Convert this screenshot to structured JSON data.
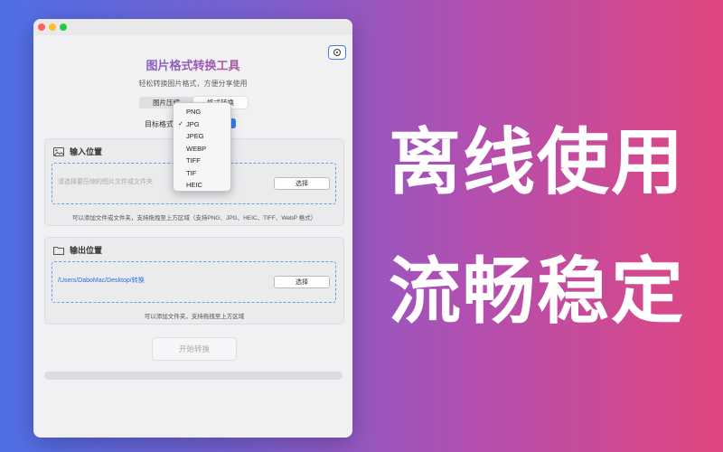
{
  "app": {
    "title": "图片格式转换工具",
    "subtitle": "轻松转换图片格式，方便分享使用",
    "tabs": [
      {
        "label": "图片压缩"
      },
      {
        "label": "格式转换"
      }
    ],
    "target_label": "目标格式"
  },
  "dropdown": {
    "selected": "JPG",
    "options": [
      "PNG",
      "JPG",
      "JPEG",
      "WEBP",
      "TIFF",
      "TIF",
      "HEIC"
    ]
  },
  "input_section": {
    "title": "输入位置",
    "placeholder": "请选择要压缩的图片文件或文件夹",
    "choose_label": "选择",
    "hint": "可以添加文件或文件夹，支持拖拽至上方区域（支持PNG、JPG、HEIC、TIFF、WebP 格式）"
  },
  "output_section": {
    "title": "输出位置",
    "path": "/Users/DaboMac/Desktop/转换",
    "choose_label": "选择",
    "hint": "可以添加文件夹，支持拖拽至上方区域"
  },
  "start_button": "开始转换",
  "progress": 0,
  "promo": {
    "line1": "离线使用",
    "line2": "流畅稳定"
  },
  "colors": {
    "accent": "#3b7cf0",
    "path_text": "#2f6fd8",
    "gradient_start": "#4f6fe6",
    "gradient_end": "#e1467f"
  }
}
